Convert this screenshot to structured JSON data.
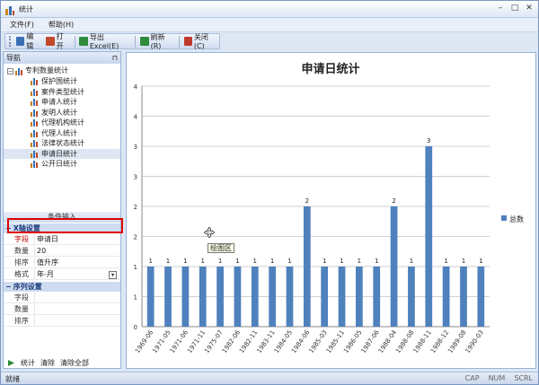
{
  "window": {
    "title": "统计",
    "minimize": "–",
    "restore": "□",
    "close": "✕"
  },
  "menu": [
    {
      "label": "文件(F)"
    },
    {
      "label": "帮助(H)"
    }
  ],
  "toolbar": [
    {
      "label": "编辑",
      "icon": "edit-icon",
      "color": "#3a6fb6"
    },
    {
      "label": "打开",
      "icon": "open-icon",
      "color": "#c04a2a"
    },
    {
      "label": "导出Excel(E)",
      "icon": "excel-icon",
      "color": "#2e8b3a"
    },
    {
      "label": "刷新(R)",
      "icon": "refresh-icon",
      "color": "#2e8b3a"
    },
    {
      "label": "关闭(C)",
      "icon": "close-icon",
      "color": "#c0392b"
    }
  ],
  "nav": {
    "header": "导航",
    "pin": "⊓",
    "root": {
      "label": "专利数量统计",
      "expander": "−"
    },
    "items": [
      {
        "label": "保护国统计",
        "selected": false
      },
      {
        "label": "案件类型统计",
        "selected": false
      },
      {
        "label": "申请人统计",
        "selected": false
      },
      {
        "label": "发明人统计",
        "selected": false
      },
      {
        "label": "代理机构统计",
        "selected": false
      },
      {
        "label": "代理人统计",
        "selected": false
      },
      {
        "label": "法律状态统计",
        "selected": false
      },
      {
        "label": "申请日统计",
        "selected": true
      },
      {
        "label": "公开日统计",
        "selected": false
      }
    ]
  },
  "conditions": {
    "header": "条件输入",
    "x_section": {
      "label": "X轴设置",
      "toggle": "−"
    },
    "x_rows": [
      {
        "name": "字段",
        "value": "申请日",
        "red": true
      },
      {
        "name": "数量",
        "value": "20",
        "red": false
      },
      {
        "name": "排序",
        "value": "值升序",
        "red": false
      }
    ],
    "format_row": {
      "name": "格式",
      "value": "年-月",
      "arrow": "▾"
    },
    "series_section": {
      "label": "序列设置",
      "toggle": "−"
    },
    "series_rows": [
      {
        "name": "字段",
        "value": ""
      },
      {
        "name": "数量",
        "value": ""
      },
      {
        "name": "排序",
        "value": ""
      }
    ],
    "actions": [
      {
        "label": "统计"
      },
      {
        "label": "清除"
      },
      {
        "label": "清除全部"
      }
    ]
  },
  "tooltip": "绘图区",
  "status": {
    "text": "就绪",
    "keys": [
      "CAP",
      "NUM",
      "SCRL"
    ]
  },
  "chart_data": {
    "type": "bar",
    "title": "申请日统计",
    "categories": [
      "1969-06",
      "1971-05",
      "1971-06",
      "1971-11",
      "1975-07",
      "1982-06",
      "1982-11",
      "1983-11",
      "1984-05",
      "1984-06",
      "1985-03",
      "1985-11",
      "1986-05",
      "1987-06",
      "1988-04",
      "1988-08",
      "1988-11",
      "1988-12",
      "1989-08",
      "1990-03"
    ],
    "series": [
      {
        "name": "总数",
        "values": [
          1,
          1,
          1,
          1,
          1,
          1,
          1,
          1,
          1,
          2,
          1,
          1,
          1,
          1,
          2,
          1,
          3,
          1,
          1,
          1
        ]
      }
    ],
    "ylim": [
      0,
      4
    ],
    "y_tick_labels": [
      "0",
      "1",
      "1",
      "2",
      "2",
      "3",
      "3",
      "4",
      "4"
    ],
    "bar_color": "#4f81bd",
    "legend_position": "right",
    "grid": true
  }
}
